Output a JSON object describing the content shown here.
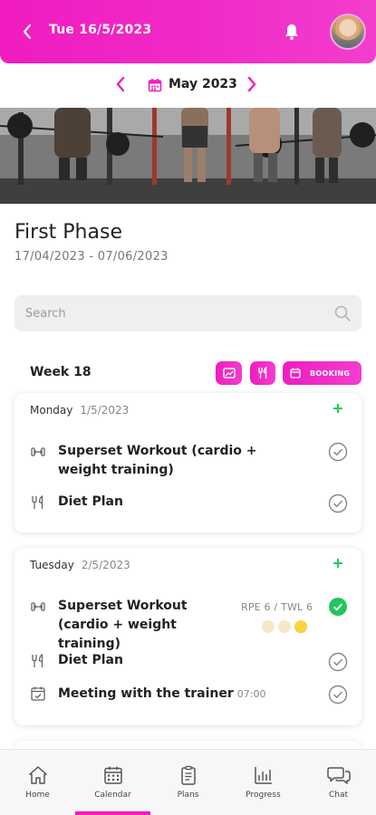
{
  "header": {
    "date": "Tue 16/5/2023",
    "gradient_start": "#f01cc0",
    "gradient_end": "#f13ecd"
  },
  "month_nav": {
    "label": "May 2023"
  },
  "phase": {
    "title": "First Phase",
    "dates": "17/04/2023 - 07/06/2023"
  },
  "search": {
    "placeholder": "Search"
  },
  "week": {
    "label": "Week 18",
    "booking_label": "BOOKING"
  },
  "days": [
    {
      "day": "Monday",
      "date": "1/5/2023",
      "items": [
        {
          "icon": "dumbbell-icon",
          "text": "Superset Workout (cardio + weight training)",
          "status": "unchecked"
        },
        {
          "icon": "fork-knife-icon",
          "text": "Diet Plan",
          "status": "unchecked"
        }
      ]
    },
    {
      "day": "Tuesday",
      "date": "2/5/2023",
      "items": [
        {
          "icon": "dumbbell-icon",
          "text": "Superset Workout (cardio + weight training)",
          "rpe": "RPE 6 / TWL 6",
          "status": "completed"
        },
        {
          "icon": "fork-knife-icon",
          "text": "Diet Plan",
          "status": "unchecked"
        },
        {
          "icon": "calendar-check-icon",
          "text": "Meeting with the trainer",
          "time": "07:00",
          "status": "unchecked"
        }
      ]
    }
  ],
  "bottom_nav": [
    {
      "label": "Home",
      "icon": "home-icon"
    },
    {
      "label": "Calendar",
      "icon": "calendar-icon",
      "active": true
    },
    {
      "label": "Plans",
      "icon": "plans-icon"
    },
    {
      "label": "Progress",
      "icon": "progress-chart-icon"
    },
    {
      "label": "Chat",
      "icon": "chat-icon"
    }
  ],
  "colors": {
    "accent": "#f01cc0",
    "plus_green": "#22cc55",
    "check_green": "#22c55e",
    "muted_text": "#888888"
  }
}
